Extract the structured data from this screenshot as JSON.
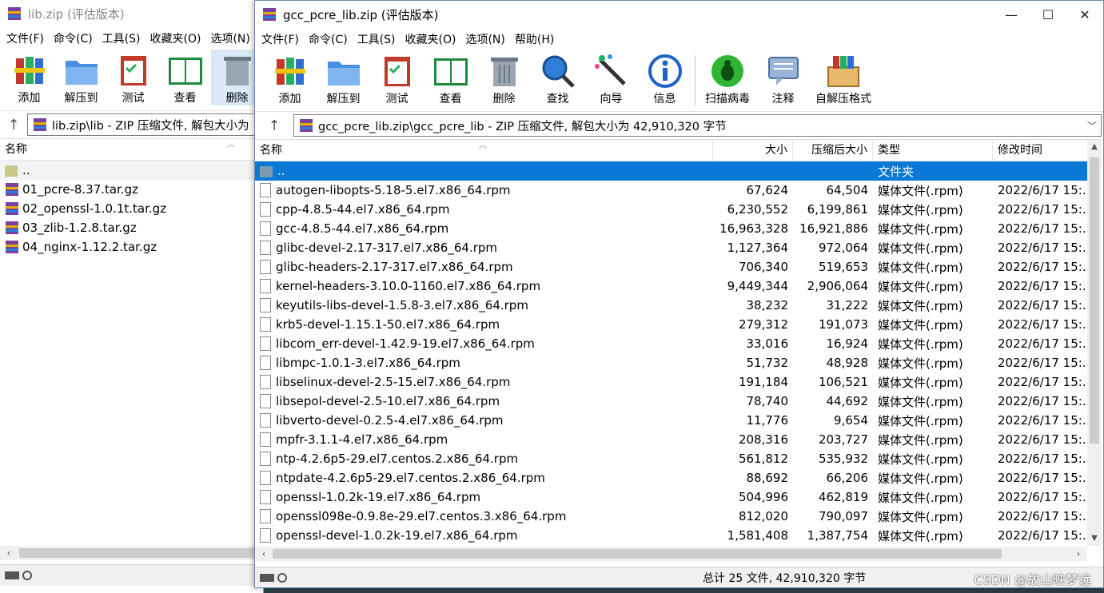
{
  "back_window": {
    "title": "lib.zip (评估版本)",
    "menu": [
      "文件(F)",
      "命令(C)",
      "工具(S)",
      "收藏夹(O)",
      "选项(N)"
    ],
    "toolbar": [
      "添加",
      "解压到",
      "测试",
      "查看",
      "删除"
    ],
    "address": "lib.zip\\lib - ZIP 压缩文件, 解包大小为",
    "header_name": "名称",
    "files": [
      {
        "name": "..",
        "type": "folder"
      },
      {
        "name": "01_pcre-8.37.tar.gz",
        "type": "archive"
      },
      {
        "name": "02_openssl-1.0.1t.tar.gz",
        "type": "archive"
      },
      {
        "name": "03_zlib-1.2.8.tar.gz",
        "type": "archive"
      },
      {
        "name": "04_nginx-1.12.2.tar.gz",
        "type": "archive"
      }
    ]
  },
  "front_window": {
    "title": "gcc_pcre_lib.zip (评估版本)",
    "controls": {
      "minimize": "—",
      "maximize": "☐",
      "close": "✕"
    },
    "menu": [
      "文件(F)",
      "命令(C)",
      "工具(S)",
      "收藏夹(O)",
      "选项(N)",
      "帮助(H)"
    ],
    "toolbar": [
      "添加",
      "解压到",
      "测试",
      "查看",
      "删除",
      "查找",
      "向导",
      "信息",
      "扫描病毒",
      "注释",
      "自解压格式"
    ],
    "address": "gcc_pcre_lib.zip\\gcc_pcre_lib - ZIP 压缩文件, 解包大小为 42,910,320 字节",
    "columns": [
      "名称",
      "大小",
      "压缩后大小",
      "类型",
      "修改时间"
    ],
    "parent_row": {
      "name": "..",
      "type": "文件夹"
    },
    "files": [
      {
        "name": "autogen-libopts-5.18-5.el7.x86_64.rpm",
        "size": "67,624",
        "packed": "64,504",
        "type": "媒体文件(.rpm)",
        "modified": "2022/6/17 15:..."
      },
      {
        "name": "cpp-4.8.5-44.el7.x86_64.rpm",
        "size": "6,230,552",
        "packed": "6,199,861",
        "type": "媒体文件(.rpm)",
        "modified": "2022/6/17 15:..."
      },
      {
        "name": "gcc-4.8.5-44.el7.x86_64.rpm",
        "size": "16,963,328",
        "packed": "16,921,886",
        "type": "媒体文件(.rpm)",
        "modified": "2022/6/17 15:..."
      },
      {
        "name": "glibc-devel-2.17-317.el7.x86_64.rpm",
        "size": "1,127,364",
        "packed": "972,064",
        "type": "媒体文件(.rpm)",
        "modified": "2022/6/17 15:..."
      },
      {
        "name": "glibc-headers-2.17-317.el7.x86_64.rpm",
        "size": "706,340",
        "packed": "519,653",
        "type": "媒体文件(.rpm)",
        "modified": "2022/6/17 15:..."
      },
      {
        "name": "kernel-headers-3.10.0-1160.el7.x86_64.rpm",
        "size": "9,449,344",
        "packed": "2,906,064",
        "type": "媒体文件(.rpm)",
        "modified": "2022/6/17 15:..."
      },
      {
        "name": "keyutils-libs-devel-1.5.8-3.el7.x86_64.rpm",
        "size": "38,232",
        "packed": "31,222",
        "type": "媒体文件(.rpm)",
        "modified": "2022/6/17 15:..."
      },
      {
        "name": "krb5-devel-1.15.1-50.el7.x86_64.rpm",
        "size": "279,312",
        "packed": "191,073",
        "type": "媒体文件(.rpm)",
        "modified": "2022/6/17 15:..."
      },
      {
        "name": "libcom_err-devel-1.42.9-19.el7.x86_64.rpm",
        "size": "33,016",
        "packed": "16,924",
        "type": "媒体文件(.rpm)",
        "modified": "2022/6/17 15:..."
      },
      {
        "name": "libmpc-1.0.1-3.el7.x86_64.rpm",
        "size": "51,732",
        "packed": "48,928",
        "type": "媒体文件(.rpm)",
        "modified": "2022/6/17 15:..."
      },
      {
        "name": "libselinux-devel-2.5-15.el7.x86_64.rpm",
        "size": "191,184",
        "packed": "106,521",
        "type": "媒体文件(.rpm)",
        "modified": "2022/6/17 15:..."
      },
      {
        "name": "libsepol-devel-2.5-10.el7.x86_64.rpm",
        "size": "78,740",
        "packed": "44,692",
        "type": "媒体文件(.rpm)",
        "modified": "2022/6/17 15:..."
      },
      {
        "name": "libverto-devel-0.2.5-4.el7.x86_64.rpm",
        "size": "11,776",
        "packed": "9,654",
        "type": "媒体文件(.rpm)",
        "modified": "2022/6/17 15:..."
      },
      {
        "name": "mpfr-3.1.1-4.el7.x86_64.rpm",
        "size": "208,316",
        "packed": "203,727",
        "type": "媒体文件(.rpm)",
        "modified": "2022/6/17 15:..."
      },
      {
        "name": "ntp-4.2.6p5-29.el7.centos.2.x86_64.rpm",
        "size": "561,812",
        "packed": "535,932",
        "type": "媒体文件(.rpm)",
        "modified": "2022/6/17 15:..."
      },
      {
        "name": "ntpdate-4.2.6p5-29.el7.centos.2.x86_64.rpm",
        "size": "88,692",
        "packed": "66,206",
        "type": "媒体文件(.rpm)",
        "modified": "2022/6/17 15:..."
      },
      {
        "name": "openssl-1.0.2k-19.el7.x86_64.rpm",
        "size": "504,996",
        "packed": "462,819",
        "type": "媒体文件(.rpm)",
        "modified": "2022/6/17 15:..."
      },
      {
        "name": "openssl098e-0.9.8e-29.el7.centos.3.x86_64.rpm",
        "size": "812,020",
        "packed": "790,097",
        "type": "媒体文件(.rpm)",
        "modified": "2022/6/17 15:..."
      },
      {
        "name": "openssl-devel-1.0.2k-19.el7.x86_64.rpm",
        "size": "1,581,408",
        "packed": "1,387,754",
        "type": "媒体文件(.rpm)",
        "modified": "2022/6/17 15:..."
      }
    ],
    "status": "总计 25 文件, 42,910,320 字节"
  },
  "watermark": "CSDN @故山映梦远",
  "colors": {
    "selection": "#0a78d7",
    "text": "#000000"
  }
}
